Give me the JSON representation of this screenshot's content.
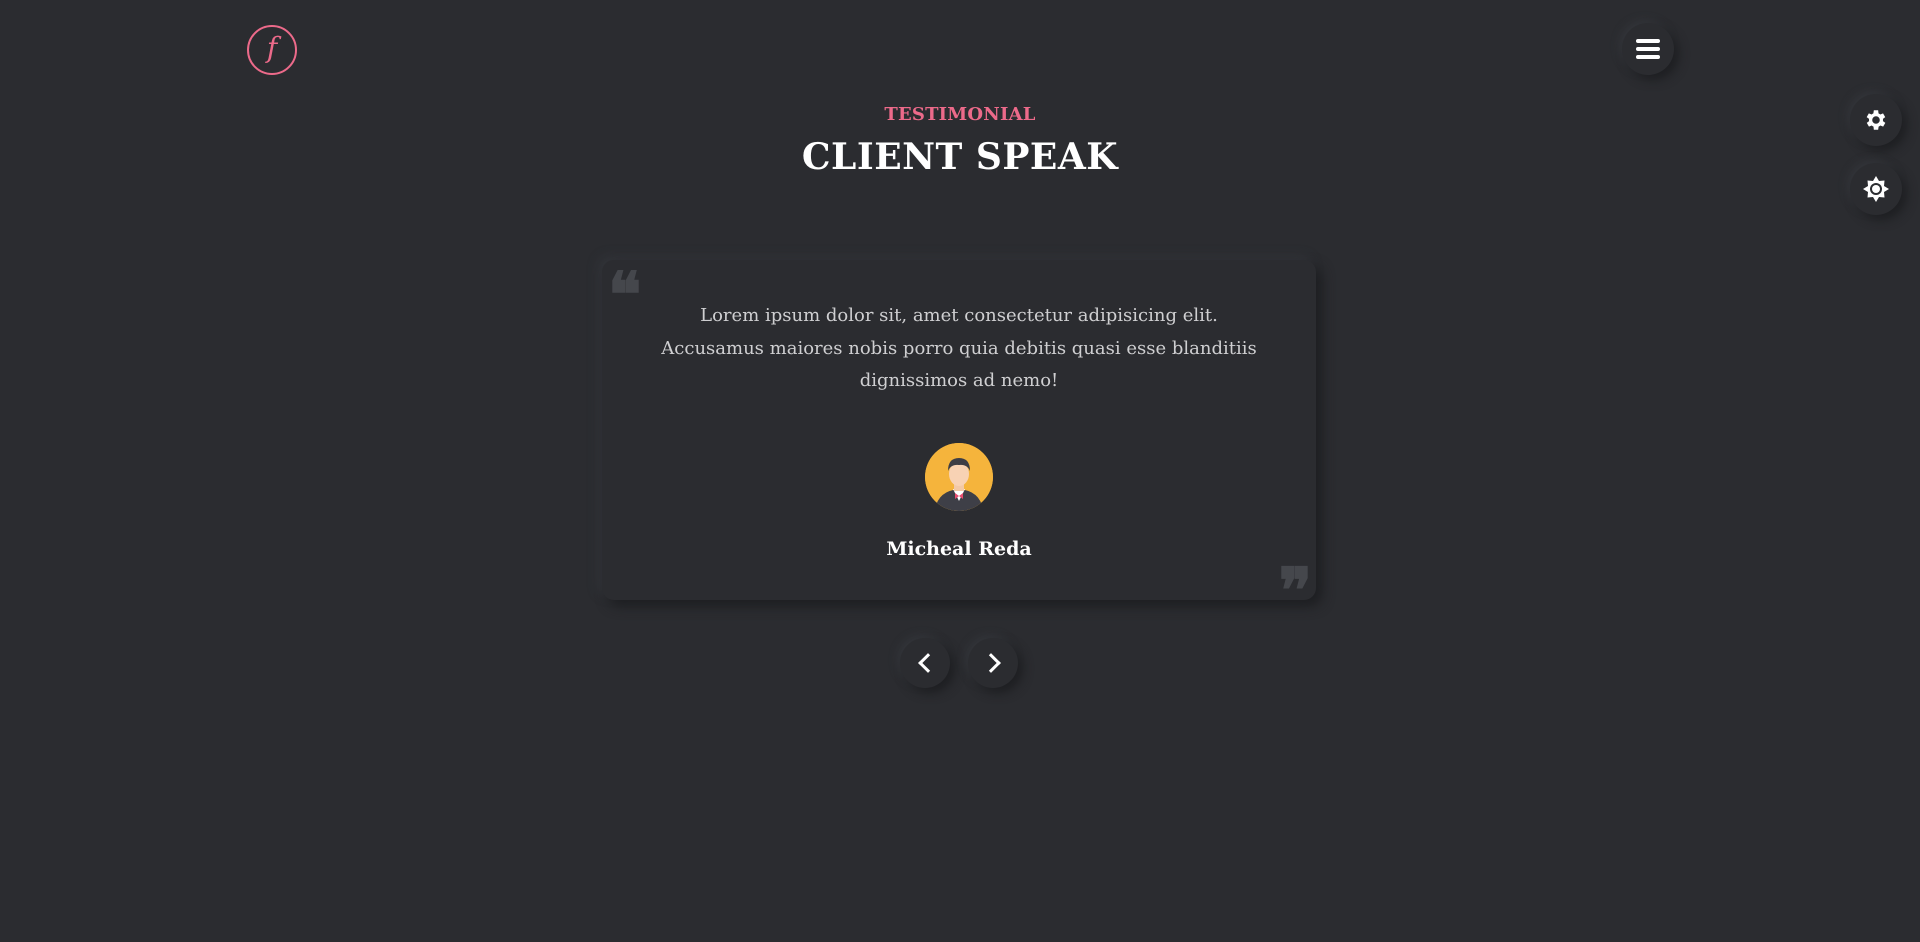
{
  "brand": {
    "logo_letter": "f",
    "accent_color": "#ec6a8a"
  },
  "header": {
    "menu_icon": "hamburger-icon"
  },
  "side_tools": [
    {
      "icon": "gear-icon"
    },
    {
      "icon": "sun-icon"
    }
  ],
  "section": {
    "eyebrow": "TESTIMONIAL",
    "title": "CLIENT SPEAK"
  },
  "testimonial": {
    "text": "Lorem ipsum dolor sit, amet consectetur adipisicing elit. Accusamus maiores nobis porro quia debitis quasi esse blanditiis dignissimos ad nemo!",
    "client_name": "Micheal Reda",
    "avatar_icon": "person-avatar-icon",
    "quote_open": "❝",
    "quote_close": "❞"
  },
  "navigation": {
    "prev_icon": "chevron-left-icon",
    "next_icon": "chevron-right-icon"
  },
  "colors": {
    "background": "#2b2c30",
    "text": "#ffffff",
    "muted_text": "#cfcfd1",
    "avatar_bg": "#f5b43c"
  }
}
